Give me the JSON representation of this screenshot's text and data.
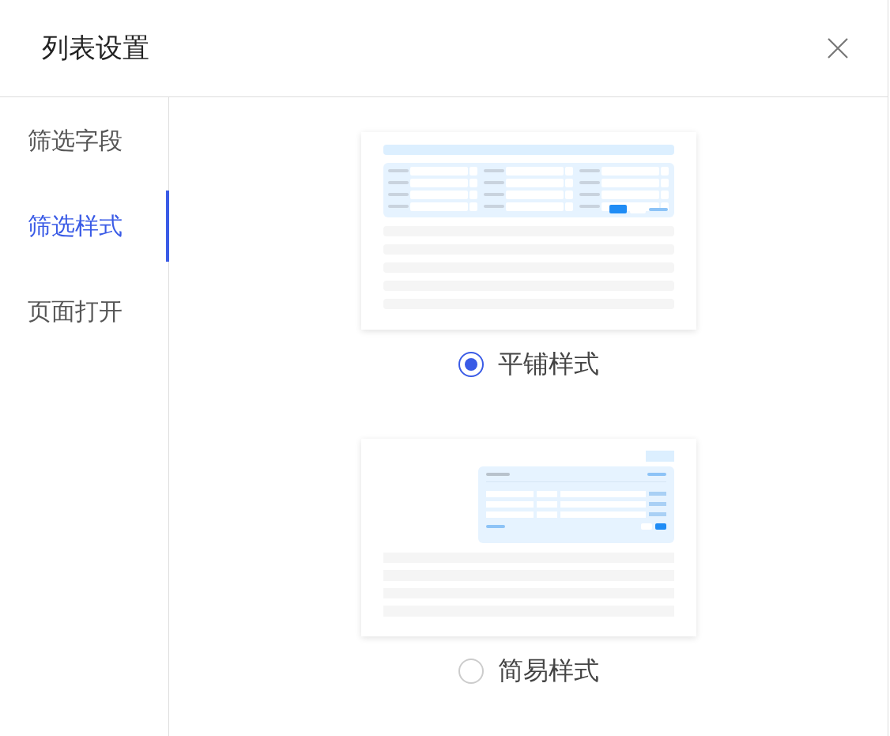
{
  "dialog": {
    "title": "列表设置"
  },
  "sidebar": {
    "items": [
      {
        "label": "筛选字段",
        "selected": false
      },
      {
        "label": "筛选样式",
        "selected": true
      },
      {
        "label": "页面打开",
        "selected": false
      }
    ]
  },
  "styles": [
    {
      "label": "平铺样式",
      "kind": "tiled",
      "selected": true
    },
    {
      "label": "简易样式",
      "kind": "simple",
      "selected": false
    }
  ]
}
